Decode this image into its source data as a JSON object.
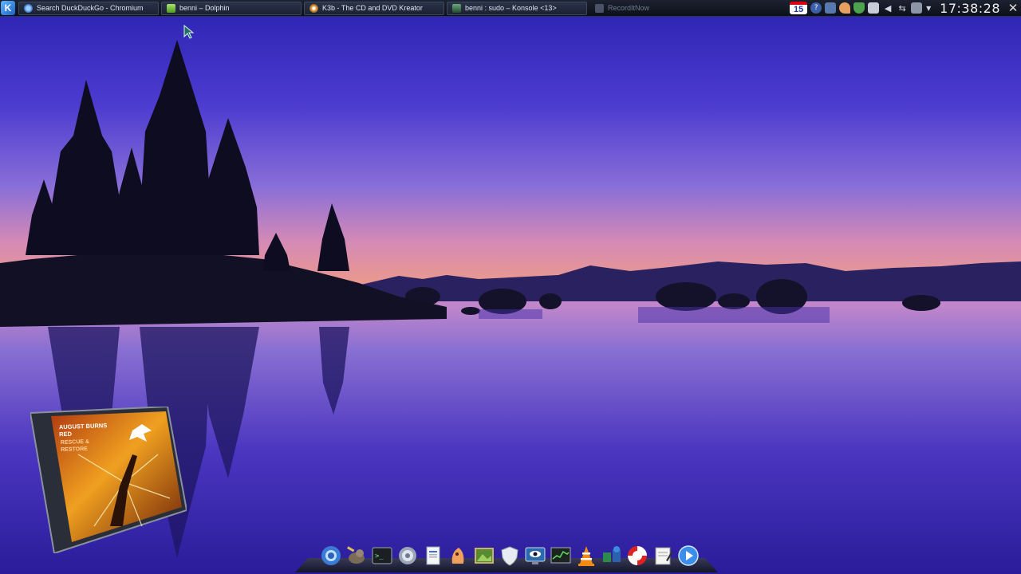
{
  "panel": {
    "launcher_icon": "kde-k-icon",
    "tasks": [
      {
        "label": "Search DuckDuckGo - Chromium",
        "icon": "chromium-icon",
        "color": "#4a8de0",
        "state": "normal"
      },
      {
        "label": "benni – Dolphin",
        "icon": "dolphin-icon",
        "color": "#7fbf3a",
        "state": "normal"
      },
      {
        "label": "K3b - The CD and DVD Kreator",
        "icon": "k3b-icon",
        "color": "#d08a30",
        "state": "normal"
      },
      {
        "label": "benni : sudo – Konsole <13>",
        "icon": "konsole-icon",
        "color": "#3e7a4e",
        "state": "normal"
      },
      {
        "label": "RecordItNow",
        "icon": "recorditnow-icon",
        "color": "#5d6a80",
        "state": "inactive"
      }
    ],
    "tray": {
      "calendar_day": "15",
      "clock": "17:38:28"
    }
  },
  "widgets": {
    "cd_cover": {
      "band": "AUGUST BURNS RED",
      "album": "RESCUE & RESTORE"
    }
  },
  "dock": {
    "items": [
      "chromium-icon",
      "gimp-icon",
      "terminal-icon",
      "settings-gear-icon",
      "document-icon",
      "kopete-icon",
      "image-viewer-icon",
      "security-shield-icon",
      "remote-desktop-icon",
      "system-monitor-icon",
      "vlc-icon",
      "network-manager-icon",
      "help-lifebuoy-icon",
      "text-editor-icon",
      "media-player-icon"
    ]
  },
  "colors": {
    "sky_top": "#3a1fb8",
    "sky_horizon": "#e07aa8",
    "water": "#3a2aa0"
  }
}
